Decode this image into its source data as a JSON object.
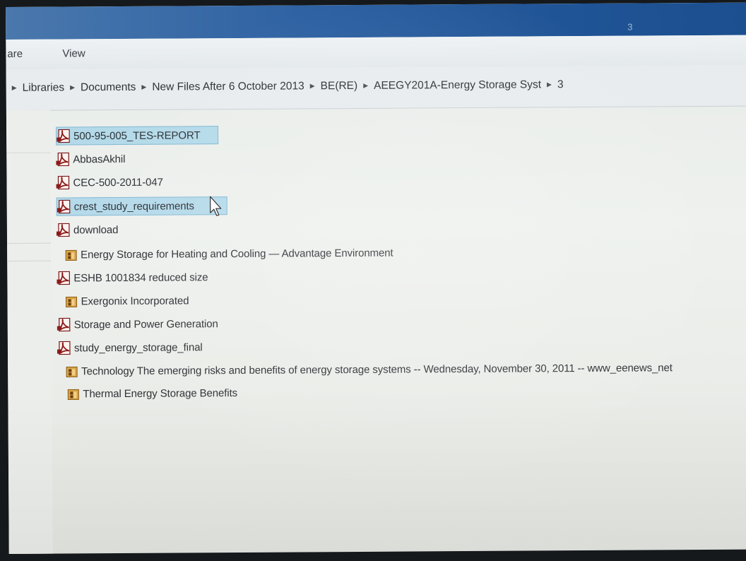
{
  "window": {
    "title": "3"
  },
  "menu": {
    "share_label": "are",
    "view_label": "View"
  },
  "breadcrumb": [
    "Libraries",
    "Documents",
    "New Files After 6 October 2013",
    "BE(RE)",
    "AEEGY201A-Energy Storage Syst",
    "3"
  ],
  "files": [
    {
      "name": "500-95-005_TES-REPORT",
      "icon": "pdf-icon",
      "selected": true
    },
    {
      "name": "AbbasAkhil",
      "icon": "pdf-icon",
      "selected": false
    },
    {
      "name": "CEC-500-2011-047",
      "icon": "pdf-icon",
      "selected": false
    },
    {
      "name": "crest_study_requirements",
      "icon": "pdf-icon",
      "selected": true
    },
    {
      "name": "download",
      "icon": "pdf-icon",
      "selected": false
    },
    {
      "name": "Energy Storage for Heating and Cooling — Advantage Environment",
      "icon": "web-page-icon",
      "selected": false
    },
    {
      "name": "ESHB 1001834 reduced size",
      "icon": "pdf-icon",
      "selected": false
    },
    {
      "name": "Exergonix Incorporated",
      "icon": "web-page-icon",
      "selected": false
    },
    {
      "name": "Storage and Power Generation",
      "icon": "pdf-icon",
      "selected": false
    },
    {
      "name": "study_energy_storage_final",
      "icon": "pdf-icon",
      "selected": false
    },
    {
      "name": "Technology The emerging risks and benefits of energy storage systems -- Wednesday, November 30, 2011 -- www_eenews_net",
      "icon": "web-page-icon",
      "selected": false
    },
    {
      "name": "Thermal Energy Storage Benefits",
      "icon": "web-page-icon",
      "selected": false
    }
  ],
  "colors": {
    "titlebar": "#1f5496",
    "selection": "#aad6e9",
    "pdf_icon": "#8b1a1a",
    "web_icon": "#b07a1e"
  }
}
